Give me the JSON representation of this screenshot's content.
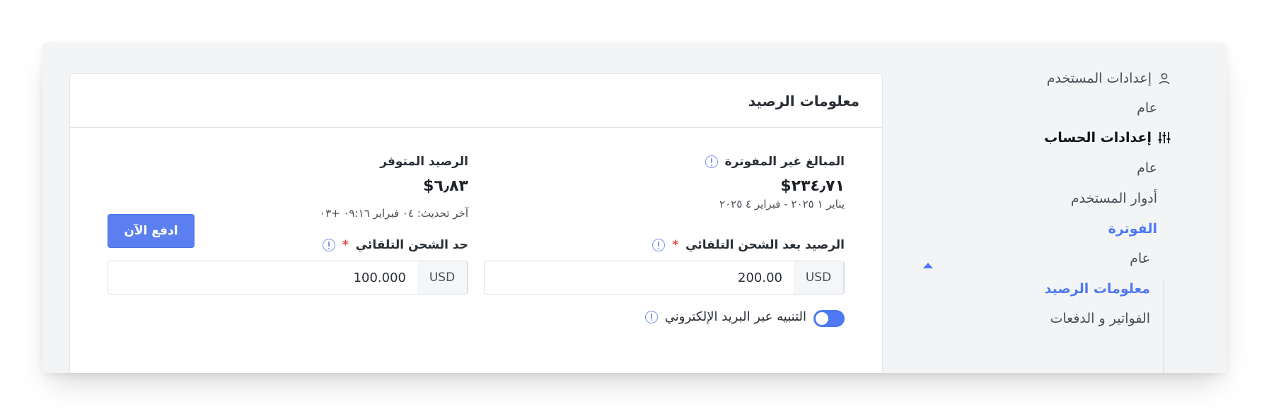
{
  "sidebar": {
    "user_settings": "إعدادات المستخدم",
    "user_general": "عام",
    "account_settings": "إعدادات الحساب",
    "account_general": "عام",
    "user_roles": "أدوار المستخدم",
    "billing": "الفوترة",
    "billing_general": "عام",
    "balance_info": "معلومات الرصيد",
    "invoices_payments": "الفواتير و الدفعات"
  },
  "card": {
    "title": "معلومات الرصيد",
    "unbilled_label": "المبالغ غير المفوترة",
    "unbilled_value": "٢٣٤٫٧١$",
    "unbilled_period": "يناير ١ ٢٠٢٥ - فبراير ٤ ٢٠٢٥",
    "available_label": "الرصيد المتوفر",
    "available_value": "٦٫٨٣$",
    "last_updated": "آخر تحديث: ٠٤ فبراير ٠٩:١٦ +٠٣",
    "pay_now": "ادفع الآن",
    "recharge_balance_label": "الرصيد بعد الشحن التلقائي",
    "recharge_balance_value": "200.00",
    "recharge_balance_unit": "USD",
    "recharge_threshold_label": "حد الشحن التلقائي",
    "recharge_threshold_value": "100.000",
    "recharge_threshold_unit": "USD",
    "required_mark": "*",
    "email_alert_label": "التنبيه عبر البريد الإلكتروني",
    "email_alert_enabled": true
  },
  "colors": {
    "accent": "#4f79f2",
    "required": "#e0453c"
  }
}
